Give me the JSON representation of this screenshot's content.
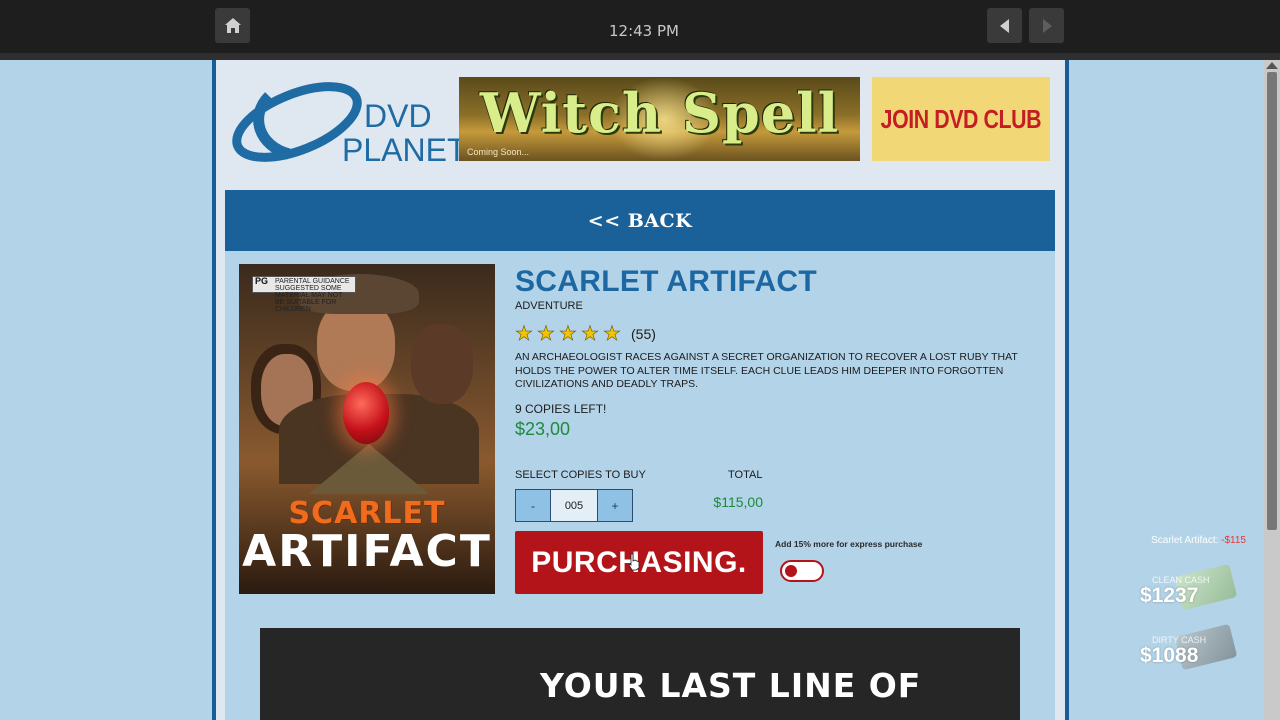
{
  "topbar": {
    "clock": "12:43 PM",
    "icons": {
      "home": "home-icon",
      "back": "arrow-left-icon",
      "forward": "arrow-right-icon"
    }
  },
  "header": {
    "logo_line1": "DVD",
    "logo_line2": "PLANET",
    "banner_title": "Witch Spell",
    "banner_subtitle": "Coming Soon...",
    "club_label": "JOIN DVD CLUB"
  },
  "nav": {
    "back_label": "<< BACK"
  },
  "product": {
    "poster_rating_badge": "PG",
    "poster_badge_text": "PARENTAL GUIDANCE SUGGESTED SOME MATERIAL MAY NOT BE SUITABLE FOR CHILDREN",
    "poster_title_line1": "SCARLET",
    "poster_title_line2": "ARTIFACT",
    "title": "SCARLET ARTIFACT",
    "genre": "ADVENTURE",
    "stars": 5,
    "rating_count": "(55)",
    "description": "AN ARCHAEOLOGIST RACES AGAINST A SECRET ORGANIZATION TO RECOVER A LOST RUBY THAT HOLDS THE POWER TO ALTER TIME ITSELF. EACH CLUE LEADS HIM DEEPER INTO FORGOTTEN CIVILIZATIONS AND DEADLY TRAPS.",
    "copies_left": "9 COPIES LEFT!",
    "price": "$23,00",
    "select_label": "SELECT COPIES TO BUY",
    "total_label": "TOTAL",
    "minus_label": "-",
    "quantity": "005",
    "plus_label": "+",
    "total_value": "$115,00",
    "purchase_label": "PURCHASING.",
    "express_label": "Add 15% more for express purchase",
    "express_enabled": false
  },
  "promo": {
    "text": "YOUR LAST LINE OF"
  },
  "hud": {
    "note_item": "Scarlet Artifact:",
    "note_amount": "-$115",
    "clean_label": "CLEAN CASH",
    "clean_value": "$1237",
    "dirty_label": "DIRTY CASH",
    "dirty_value": "$1088"
  },
  "colors": {
    "brand_blue": "#1b6199",
    "price_green": "#1e8a3c",
    "purchase_red": "#b3141a",
    "club_yellow": "#f2d777"
  }
}
